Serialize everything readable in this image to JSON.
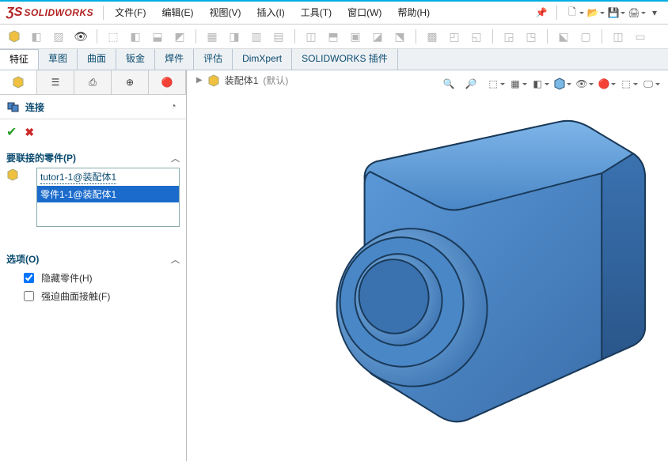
{
  "app": {
    "logo_text": "SOLIDWORKS"
  },
  "menu": {
    "items": [
      "文件(F)",
      "编辑(E)",
      "视图(V)",
      "插入(I)",
      "工具(T)",
      "窗口(W)",
      "帮助(H)"
    ]
  },
  "tabs": {
    "items": [
      "特征",
      "草图",
      "曲面",
      "钣金",
      "焊件",
      "评估",
      "DimXpert",
      "SOLIDWORKS 插件"
    ],
    "active": 0
  },
  "crumb": {
    "doc": "装配体1",
    "state": "(默认)"
  },
  "feature_panel": {
    "title": "连接",
    "parts_section": "要联接的零件(P)",
    "parts": [
      {
        "label": "tutor1-1@装配体1",
        "selected": false,
        "linked": true
      },
      {
        "label": "零件1-1@装配体1",
        "selected": true,
        "linked": false
      }
    ],
    "options_section": "选项(O)",
    "options": [
      {
        "label": "隐藏零件(H)",
        "checked": true
      },
      {
        "label": "强迫曲面接触(F)",
        "checked": false
      }
    ]
  }
}
